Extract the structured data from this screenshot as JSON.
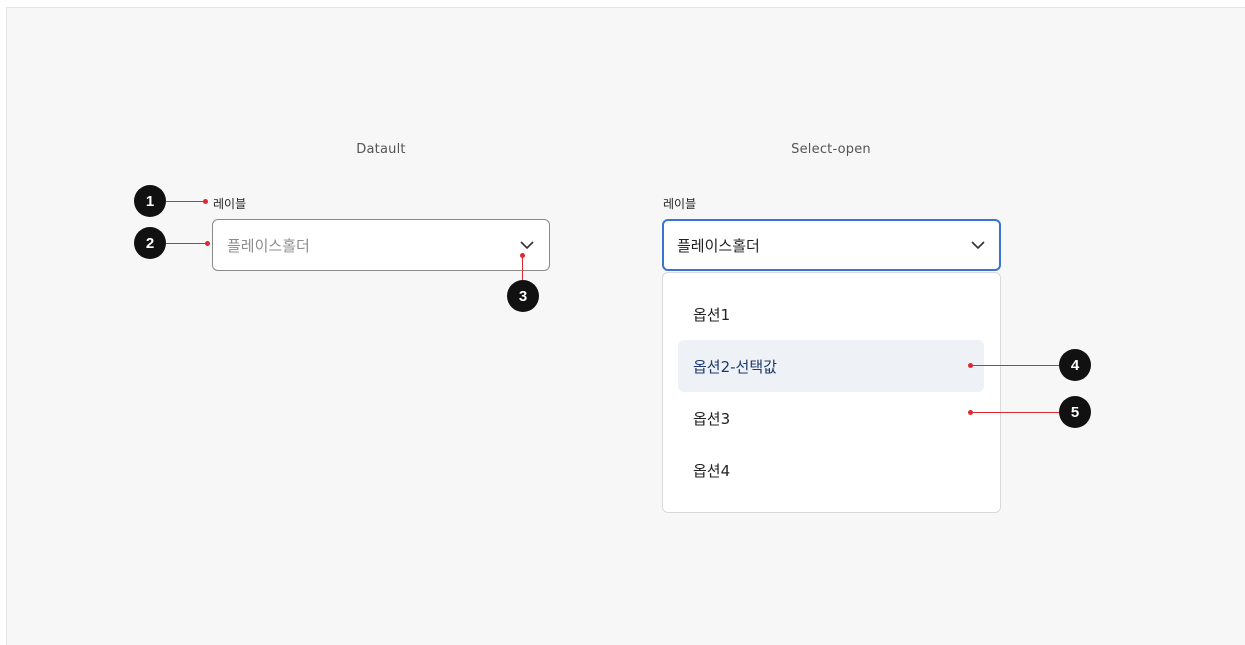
{
  "sections": {
    "default_title": "Datault",
    "open_title": "Select-open"
  },
  "default_select": {
    "label": "레이블",
    "placeholder": "플레이스홀더",
    "icon": "chevron-down-icon"
  },
  "open_select": {
    "label": "레이블",
    "value": "플레이스홀더",
    "icon": "chevron-down-icon",
    "options": [
      {
        "label": "옵션1",
        "selected": false
      },
      {
        "label": "옵션2-선택값",
        "selected": true
      },
      {
        "label": "옵션3",
        "selected": false
      },
      {
        "label": "옵션4",
        "selected": false
      }
    ]
  },
  "annotations": [
    "1",
    "2",
    "3",
    "4",
    "5"
  ],
  "colors": {
    "focus_border": "#3b73d1",
    "annotation_line": "#e0292f",
    "selected_bg": "#eef1f5",
    "selected_text": "#1d3a6e"
  }
}
